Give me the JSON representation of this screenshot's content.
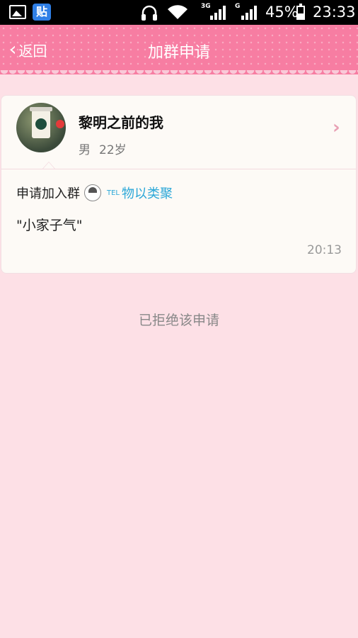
{
  "status_bar": {
    "network_3g": "3G",
    "network_g": "G",
    "battery_pct": "45%",
    "battery_level": 0.45,
    "time": "23:33",
    "tieba_label": "贴"
  },
  "header": {
    "back_label": "返回",
    "title": "加群申请"
  },
  "request": {
    "name": "黎明之前的我",
    "gender": "男",
    "age": "22岁",
    "apply_prefix": "申请加入群",
    "group_tel": "TEL",
    "group_name": "物以类聚",
    "message": "\"小家子气\"",
    "time": "20:13"
  },
  "result_text": "已拒绝该申请",
  "colors": {
    "header_bg": "#f77da2",
    "page_bg": "#fde0e6",
    "link": "#2aa7d8"
  }
}
